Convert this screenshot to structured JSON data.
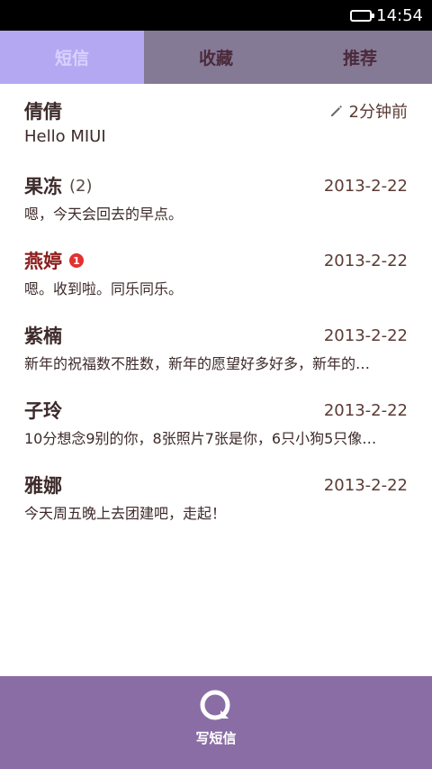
{
  "status": {
    "time": "14:54"
  },
  "tabs": [
    {
      "label": "短信",
      "active": true
    },
    {
      "label": "收藏",
      "active": false
    },
    {
      "label": "推荐",
      "active": false
    }
  ],
  "conversations": [
    {
      "name": "倩倩",
      "count": "",
      "badge": "",
      "time": "2分钟前",
      "preview": "Hello MIUI"
    },
    {
      "name": "果冻",
      "count": "(2)",
      "badge": "",
      "time": "2013-2-22",
      "preview": "嗯，今天会回去的早点。"
    },
    {
      "name": "燕婷",
      "count": "",
      "badge": "1",
      "time": "2013-2-22",
      "preview": "嗯。收到啦。同乐同乐。"
    },
    {
      "name": "紫楠",
      "count": "",
      "badge": "",
      "time": "2013-2-22",
      "preview": "新年的祝福数不胜数，新年的愿望好多好多，新年的…"
    },
    {
      "name": "子玲",
      "count": "",
      "badge": "",
      "time": "2013-2-22",
      "preview": "10分想念9别的你，8张照片7张是你，6只小狗5只像…"
    },
    {
      "name": "雅娜",
      "count": "",
      "badge": "",
      "time": "2013-2-22",
      "preview": "今天周五晚上去团建吧，走起！"
    }
  ],
  "bottom": {
    "compose_label": "写短信"
  },
  "colors": {
    "accent": "#b5a8f3",
    "tabbar": "#847a95",
    "bottom_bar": "#8a6da4",
    "badge": "#e53030"
  }
}
